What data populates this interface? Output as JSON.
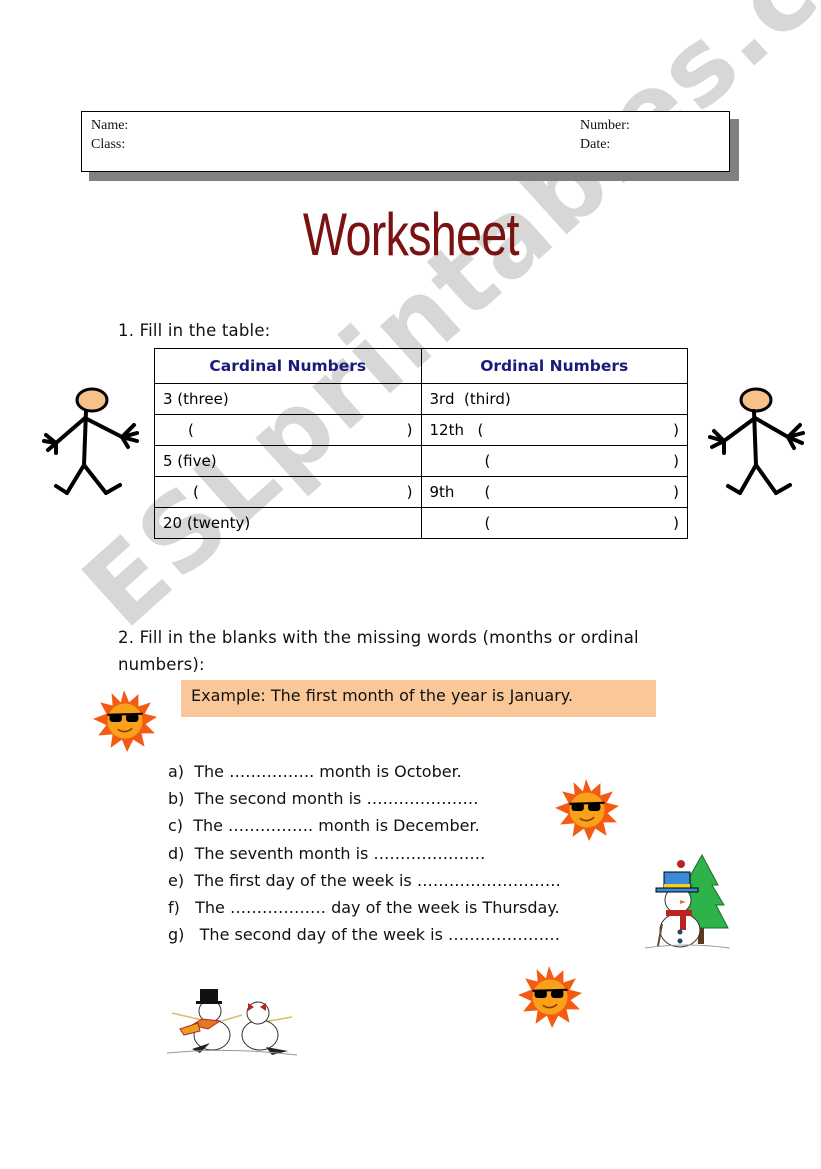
{
  "header": {
    "name_label": "Name:",
    "class_label": "Class:",
    "number_label": "Number:",
    "date_label": "Date:"
  },
  "title": "Worksheet",
  "exercise1": {
    "instruction": "1. Fill in the table:",
    "columns": [
      "Cardinal Numbers",
      "Ordinal Numbers"
    ],
    "rows": [
      {
        "cardinal": "3 (three)",
        "cardinal_blank": false,
        "ordinal": "3rd  (third)",
        "ordinal_blank": false
      },
      {
        "cardinal": "",
        "cardinal_blank": true,
        "ordinal": "12th",
        "ordinal_blank": true
      },
      {
        "cardinal": "5 (five)",
        "cardinal_blank": false,
        "ordinal": "",
        "ordinal_blank": true
      },
      {
        "cardinal": "",
        "cardinal_blank": true,
        "ordinal": "9th",
        "ordinal_blank": true
      },
      {
        "cardinal": "20 (twenty)",
        "cardinal_blank": false,
        "ordinal": "",
        "ordinal_blank": true
      }
    ],
    "paren_open": "(",
    "paren_close": ")"
  },
  "exercise2": {
    "instruction_line1": "2. Fill in the blanks with the missing words (months or ordinal",
    "instruction_line2": "numbers):",
    "example": "Example: The first month of the year is January.",
    "items": [
      "a)  The ……………. month is October.",
      "b)  The second month is …………………",
      "c)  The ……………. month is December.",
      "d)  The seventh month is …………………",
      "e)  The first day of the week is ………………………",
      "f)   The ……………… day of the week is Thursday.",
      "g)   The second day of the week is …………………"
    ]
  },
  "images": {
    "left_figure": "stick-figure",
    "right_figure": "stick-figure",
    "suns": [
      "sun-with-sunglasses",
      "sun-with-sunglasses",
      "sun-with-sunglasses"
    ],
    "snowman_tree": "snowman-with-tree",
    "snowman_couple": "snowman-couple"
  },
  "watermark": "ESLprintables.com",
  "colors": {
    "title": "#7a1212",
    "table_header": "#1a1a7a",
    "example_bg": "#fac898"
  }
}
